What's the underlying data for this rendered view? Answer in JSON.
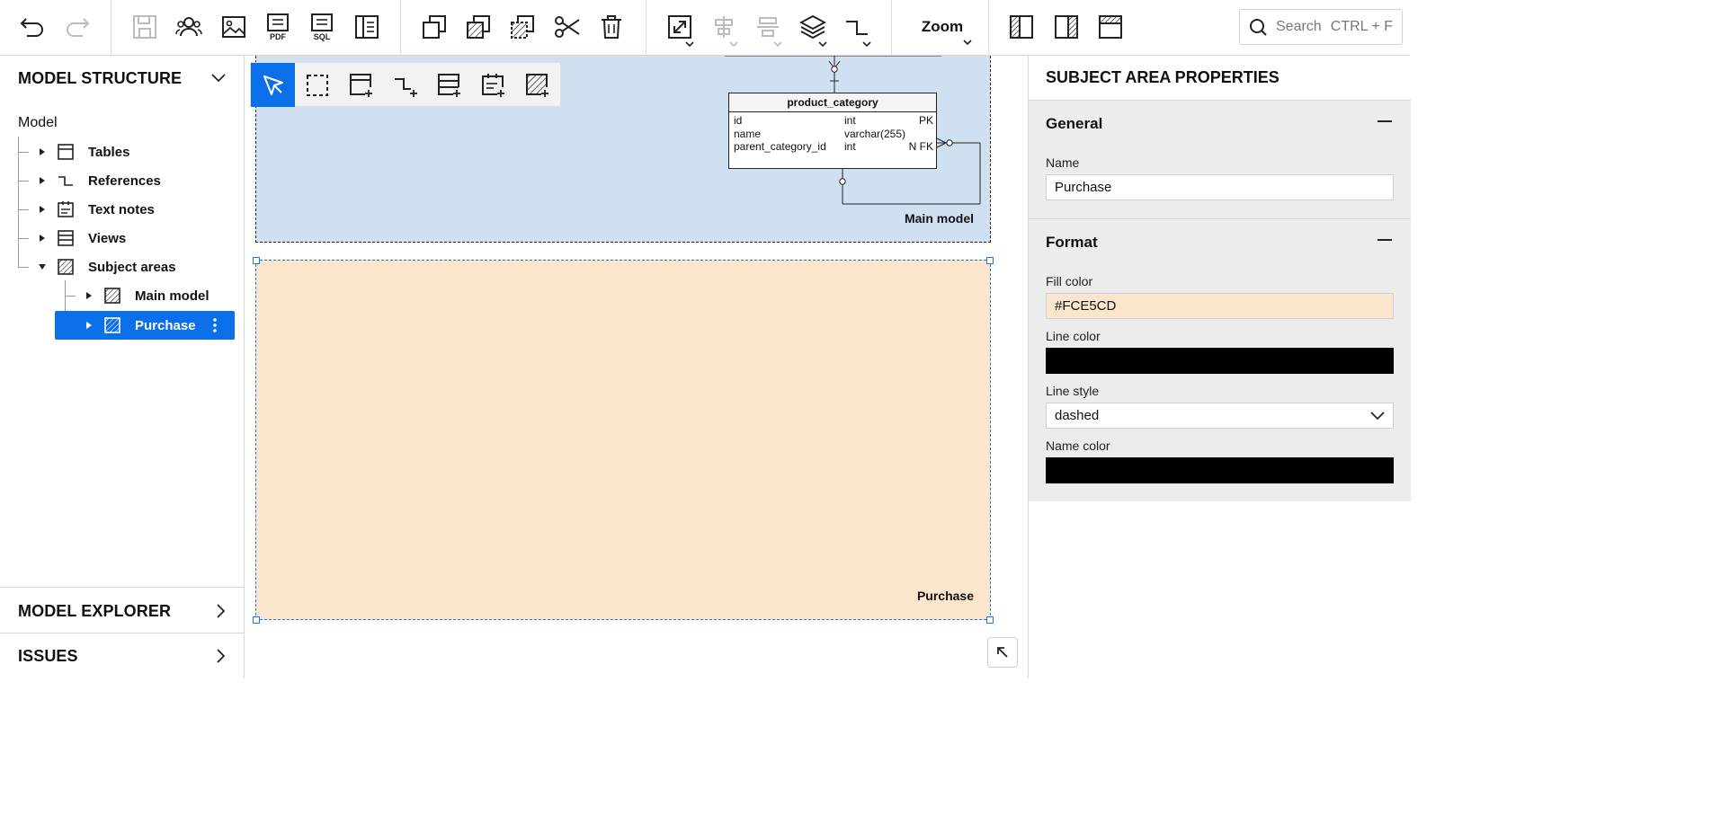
{
  "toolbar": {
    "zoom_label": "Zoom",
    "search_placeholder": "Search",
    "search_shortcut": "CTRL + F"
  },
  "left_panel": {
    "model_structure_title": "MODEL STRUCTURE",
    "model_root": "Model",
    "tree": [
      {
        "label": "Tables",
        "icon": "table-icon",
        "expanded": false
      },
      {
        "label": "References",
        "icon": "reference-icon",
        "expanded": false
      },
      {
        "label": "Text notes",
        "icon": "text-note-icon",
        "expanded": false
      },
      {
        "label": "Views",
        "icon": "view-icon",
        "expanded": false
      },
      {
        "label": "Subject areas",
        "icon": "subject-area-icon",
        "expanded": true
      }
    ],
    "subject_areas": [
      {
        "label": "Main model",
        "selected": false
      },
      {
        "label": "Purchase",
        "selected": true
      }
    ],
    "model_explorer_title": "MODEL EXPLORER",
    "issues_title": "ISSUES"
  },
  "canvas": {
    "main_area_label": "Main model",
    "purchase_area_label": "Purchase",
    "table": {
      "name": "product_category",
      "columns": [
        {
          "name": "id",
          "type": "int",
          "flags": "PK"
        },
        {
          "name": "name",
          "type": "varchar(255)",
          "flags": ""
        },
        {
          "name": "parent_category_id",
          "type": "int",
          "flags": "N FK"
        }
      ]
    },
    "colors": {
      "main_fill": "#CFE0F1",
      "purchase_fill": "#FCE5CD",
      "accent": "#0A6FE8"
    }
  },
  "right_panel": {
    "title": "SUBJECT AREA PROPERTIES",
    "general": {
      "title": "General",
      "name_label": "Name",
      "name_value": "Purchase"
    },
    "format": {
      "title": "Format",
      "fill_color_label": "Fill color",
      "fill_color_value": "#FCE5CD",
      "line_color_label": "Line color",
      "line_style_label": "Line style",
      "line_style_value": "dashed",
      "name_color_label": "Name color"
    }
  }
}
